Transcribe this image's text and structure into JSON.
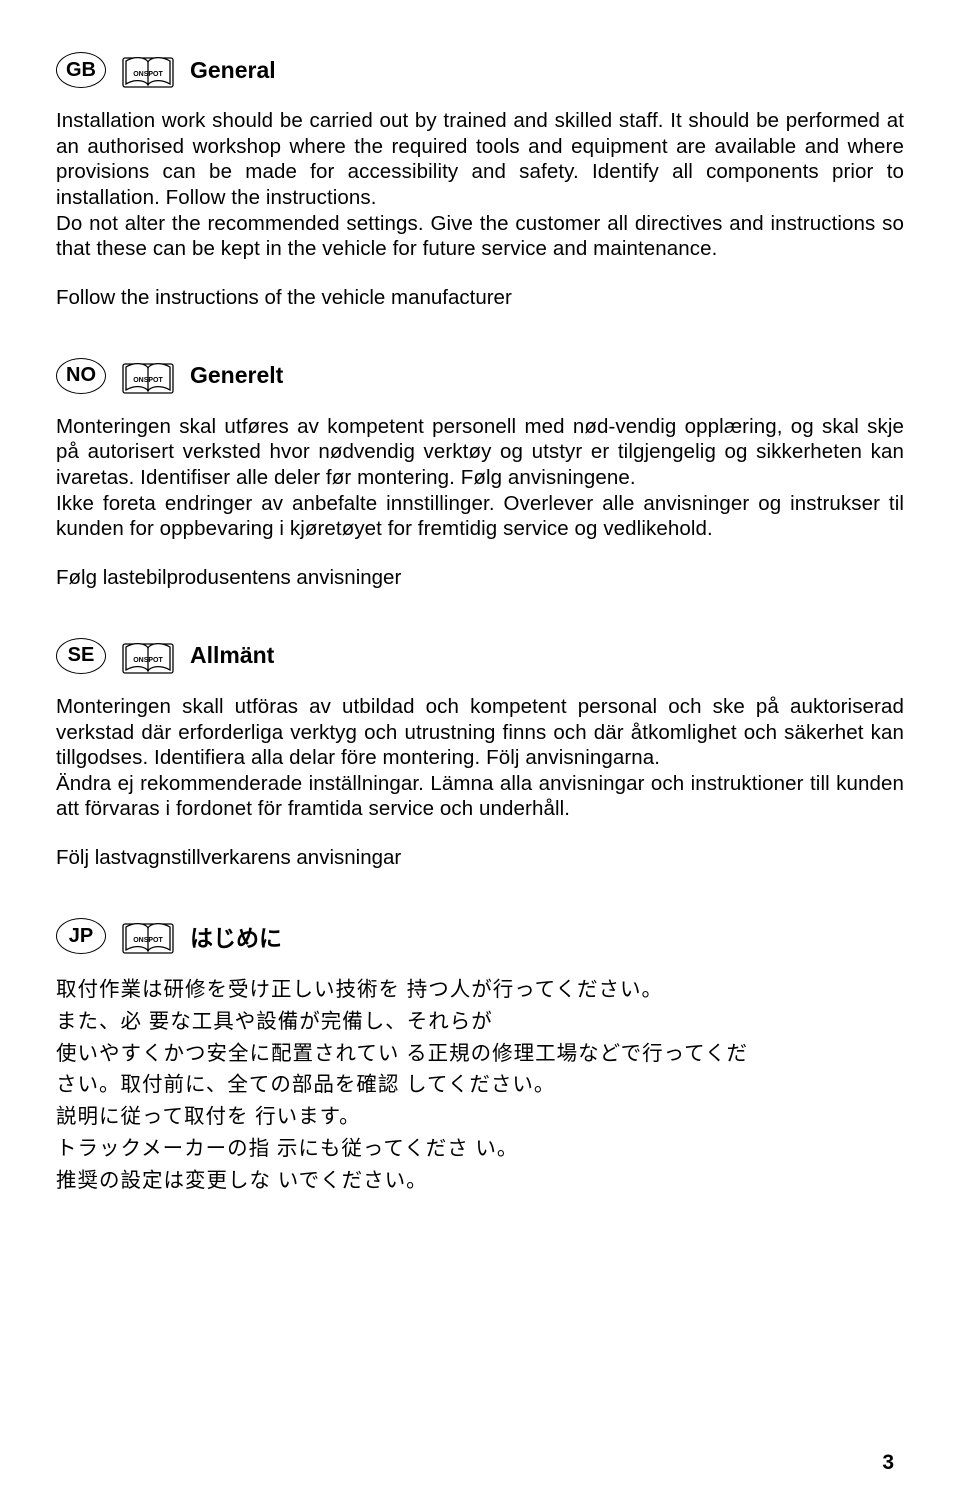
{
  "sections": [
    {
      "lang": "GB",
      "title": "General",
      "body": "Installation work should be carried out by trained and skilled staff. It should be performed at an authorised workshop where the required tools and equipment are available and where provisions can be made for accessibility and safety. Identify all components prior to installation. Follow the instructions.\nDo not alter the recommended settings. Give the customer all directives and instructions so that these can be kept in the vehicle for future service and maintenance.",
      "follow": "Follow the instructions of the vehicle manufacturer"
    },
    {
      "lang": "NO",
      "title": "Generelt",
      "body": "Monteringen skal utføres av kompetent personell med nød-vendig opplæring, og skal skje på autorisert verksted hvor nødvendig verktøy og utstyr er tilgjengelig og sikkerheten kan ivaretas. Identifiser alle deler før montering. Følg anvisningene.\nIkke foreta endringer av anbefalte innstillinger. Overlever alle anvisninger og instrukser til kunden for oppbevaring i kjøretøyet for fremtidig service og vedlikehold.",
      "follow": "Følg lastebilprodusentens anvisninger"
    },
    {
      "lang": "SE",
      "title": "Allmänt",
      "body": "Monteringen skall utföras av utbildad och kompetent personal och ske på auktoriserad verkstad där erforderliga verktyg och utrustning finns och där åtkomlighet och säkerhet kan tillgodses. Identifiera alla delar före montering. Följ anvisningarna.\nÄndra ej rekommenderade inställningar. Lämna alla anvisningar och instruktioner till kunden att förvaras i fordonet för framtida service och underhåll.",
      "follow": "Följ lastvagnstillverkarens anvisningar"
    },
    {
      "lang": "JP",
      "title": "はじめに",
      "body": "取付作業は研修を受け正しい技術を 持つ人が行ってください。\nまた、必 要な工具や設備が完備し、それらが\n使いやすくかつ安全に配置されてい る正規の修理工場などで行ってくだ\nさい。取付前に、全ての部品を確認 してください。\n説明に従って取付を 行います。\nトラックメーカーの指 示にも従ってくださ い。\n推奨の設定は変更しな いでください。",
      "follow": ""
    }
  ],
  "brand": "ONSPOT",
  "page_number": "3"
}
